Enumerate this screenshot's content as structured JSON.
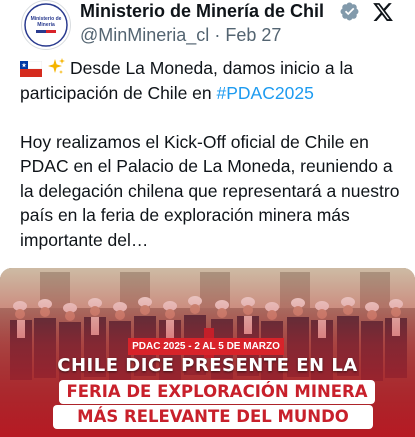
{
  "account": {
    "name": "Ministerio de Minería de Chil",
    "handle": "@MinMineria_cl",
    "separator": "·",
    "date": "Feb 27",
    "avatar_text": "Ministerio de Minería"
  },
  "tweet": {
    "line1_text": "Desde La Moneda, damos inicio a la participación de Chile en ",
    "hashtag": "#PDAC2025",
    "paragraph2": "Hoy realizamos el Kick-Off oficial de Chile en PDAC en el Palacio de La Moneda, reuniendo a la delegación chilena que representará a nuestro país en la feria de exploración minera más importante del…"
  },
  "media": {
    "tag": "PDAC 2025 - 2 AL 5 DE MARZO",
    "caption1": "CHILE DICE PRESENTE EN LA",
    "caption2": "FERIA DE EXPLORACIÓN MINERA",
    "caption3": "MÁS RELEVANTE DEL MUNDO"
  },
  "colors": {
    "link": "#1d9bf0",
    "verified": "#829aab",
    "brand_red": "#d8232a"
  },
  "icons": {
    "verified": "verified-badge-icon",
    "platform": "x-logo-icon",
    "flag": "chile-flag-emoji",
    "sparkles": "sparkles-emoji"
  }
}
